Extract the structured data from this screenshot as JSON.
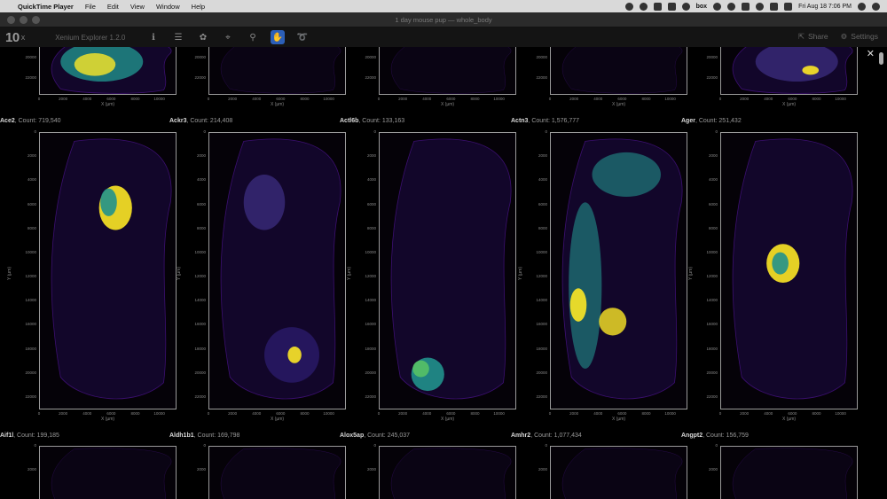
{
  "menubar": {
    "app_name": "QuickTime Player",
    "items": [
      "File",
      "Edit",
      "View",
      "Window",
      "Help"
    ],
    "datetime": "Fri Aug 18  7:06 PM",
    "box_label": "box"
  },
  "window": {
    "title": "1 day mouse pup — whole_body"
  },
  "toolbar": {
    "logo": "10",
    "logo_suffix": "x",
    "app_title": "Xenium Explorer 1.2.0",
    "share_label": "Share",
    "settings_label": "Settings"
  },
  "axis": {
    "x_label": "X (µm)",
    "y_label": "Y (µm)",
    "x_ticks": [
      "0",
      "2000",
      "4000",
      "6000",
      "8000",
      "10000"
    ],
    "y_ticks": [
      "0",
      "2000",
      "4000",
      "6000",
      "8000",
      "10000",
      "12000",
      "14000",
      "16000",
      "18000",
      "20000",
      "22000"
    ],
    "top_row_y_ticks": [
      "20000",
      "22000"
    ],
    "bottom_row_y_ticks": [
      "0",
      "2000"
    ]
  },
  "top_row": [
    {
      "id": "t1"
    },
    {
      "id": "t2"
    },
    {
      "id": "t3"
    },
    {
      "id": "t4"
    },
    {
      "id": "t5"
    }
  ],
  "middle_row": [
    {
      "gene": "Ace2",
      "count_text": ", Count: 719,540"
    },
    {
      "gene": "Ackr3",
      "count_text": ", Count: 214,408"
    },
    {
      "gene": "Actl6b",
      "count_text": ", Count: 133,163"
    },
    {
      "gene": "Actn3",
      "count_text": ", Count: 1,576,777"
    },
    {
      "gene": "Ager",
      "count_text": ", Count: 251,432"
    }
  ],
  "bottom_row": [
    {
      "gene": "Aif1l",
      "count_text": ", Count: 199,185"
    },
    {
      "gene": "Aldh1b1",
      "count_text": ", Count: 169,798"
    },
    {
      "gene": "Alox5ap",
      "count_text": ", Count: 245,037"
    },
    {
      "gene": "Amhr2",
      "count_text": ", Count: 1,077,434"
    },
    {
      "gene": "Angpt2",
      "count_text": ", Count: 156,759"
    }
  ],
  "colors": {
    "viridis_low": "#3b0f70",
    "viridis_mid": "#21918c",
    "viridis_high": "#fde725",
    "accent_blue": "#2c5fb8"
  }
}
